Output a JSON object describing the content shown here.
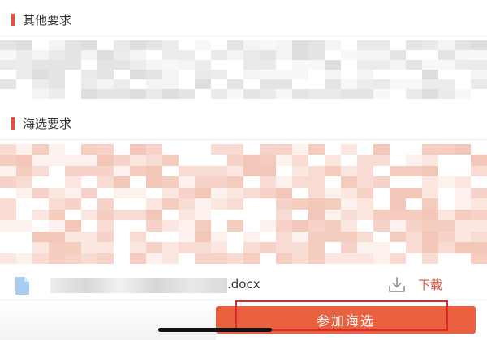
{
  "sections": {
    "other_requirements": {
      "title": "其他要求"
    },
    "audition_requirements": {
      "title": "海选要求"
    }
  },
  "attachment": {
    "file_extension": ".docx",
    "download_label": "下载",
    "icon": "document-icon"
  },
  "actions": {
    "join_audition_label": "参加海选"
  },
  "colors": {
    "accent": "#e0523a",
    "button": "#ea6140",
    "highlight_outline": "#e0262a"
  }
}
